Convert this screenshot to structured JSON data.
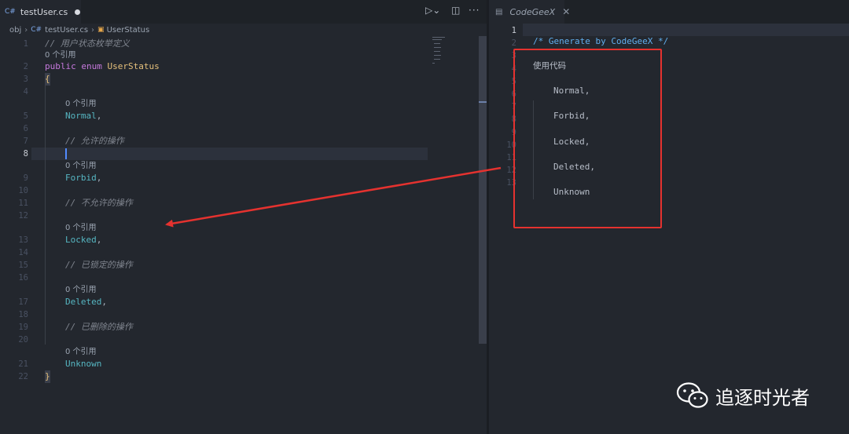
{
  "tabs": {
    "file_tab": {
      "badge": "C#",
      "label": "testUser.cs"
    },
    "panel_tab": {
      "label": "CodeGeeX"
    }
  },
  "breadcrumb": {
    "folder": "obj",
    "badge": "C#",
    "file": "testUser.cs",
    "symbol": "UserStatus"
  },
  "editor": {
    "active_line": "8",
    "lines": {
      "l1": {
        "num": "1",
        "text": "// 用户状态枚举定义"
      },
      "lens1": "0 个引用",
      "l2": {
        "num": "2",
        "kw1": "public",
        "kw2": "enum",
        "type": "UserStatus"
      },
      "l3": {
        "num": "3",
        "text": "{"
      },
      "l4": {
        "num": "4"
      },
      "lens5": "0 个引用",
      "l5": {
        "num": "5",
        "text": "Normal",
        "punct": ","
      },
      "l6": {
        "num": "6"
      },
      "l7": {
        "num": "7",
        "text": "// 允许的操作"
      },
      "l8": {
        "num": "8"
      },
      "lens9": "0 个引用",
      "l9": {
        "num": "9",
        "text": "Forbid",
        "punct": ","
      },
      "l10": {
        "num": "10"
      },
      "l11": {
        "num": "11",
        "text": "// 不允许的操作"
      },
      "l12": {
        "num": "12"
      },
      "lens13": "0 个引用",
      "l13": {
        "num": "13",
        "text": "Locked",
        "punct": ","
      },
      "l14": {
        "num": "14"
      },
      "l15": {
        "num": "15",
        "text": "// 已锁定的操作"
      },
      "l16": {
        "num": "16"
      },
      "lens17": "0 个引用",
      "l17": {
        "num": "17",
        "text": "Deleted",
        "punct": ","
      },
      "l18": {
        "num": "18"
      },
      "l19": {
        "num": "19",
        "text": "// 已删除的操作"
      },
      "l20": {
        "num": "20"
      },
      "lens21": "0 个引用",
      "l21": {
        "num": "21",
        "text": "Unknown"
      },
      "l22": {
        "num": "22",
        "text": "}"
      }
    }
  },
  "codegeex": {
    "line_numbers": [
      "1",
      "2",
      "3",
      "4",
      "5",
      "6",
      "7",
      "8",
      "9",
      "10",
      "11",
      "12",
      "13"
    ],
    "header_comment": "/* Generate by CodeGeeX */",
    "use_code_label": "使用代码",
    "items": [
      "Normal,",
      "Forbid,",
      "Locked,",
      "Deleted,",
      "Unknown"
    ]
  },
  "watermark": {
    "text": "追逐时光者",
    "icon": "wechat-icon"
  },
  "colors": {
    "highlight_box": "#e5322f",
    "arrow": "#e5322f",
    "background": "#23272e"
  }
}
